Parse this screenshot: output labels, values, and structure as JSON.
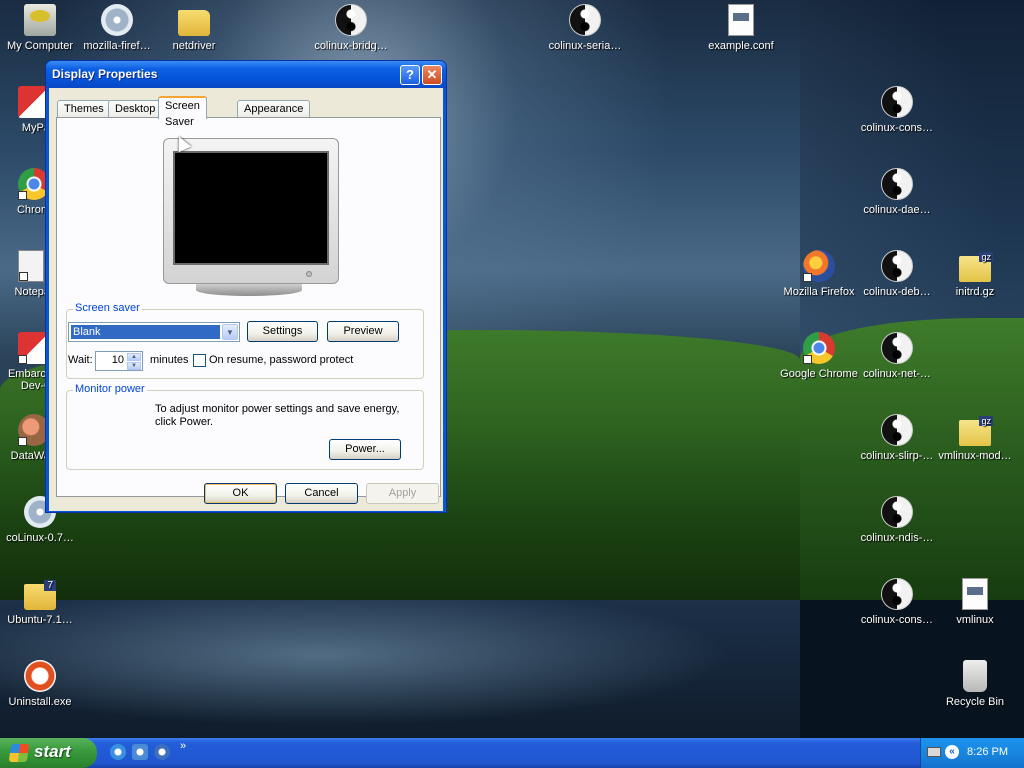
{
  "desktop": {
    "icons_left": [
      {
        "label": "My Computer",
        "icon": "computer-icon"
      },
      {
        "label": "mozilla-firef…",
        "icon": "cd-icon"
      },
      {
        "label": "netdriver",
        "icon": "folder-icon"
      },
      {
        "label": "colinux-bridg…",
        "icon": "yin-yang-icon"
      },
      {
        "label": "colinux-seria…",
        "icon": "yin-yang-icon"
      },
      {
        "label": "example.conf",
        "icon": "config-file-icon"
      },
      {
        "label": "MyPa",
        "icon": "app-icon"
      },
      {
        "label": "Chrom",
        "icon": "chrome-icon"
      },
      {
        "label": "Notepa",
        "icon": "notepad-icon"
      },
      {
        "label": "Embarca Dev-C",
        "icon": "devcpp-icon"
      },
      {
        "label": "DataWa",
        "icon": "database-icon"
      },
      {
        "label": "coLinux-0.7…",
        "icon": "installer-icon"
      },
      {
        "label": "Ubuntu-7.1…",
        "icon": "archive-icon"
      },
      {
        "label": "Uninstall.exe",
        "icon": "uninstall-icon"
      }
    ],
    "icons_right": [
      {
        "label": "colinux-cons…",
        "icon": "yin-yang-icon"
      },
      {
        "label": "colinux-dae…",
        "icon": "yin-yang-icon"
      },
      {
        "label": "Mozilla Firefox",
        "icon": "firefox-icon"
      },
      {
        "label": "colinux-deb…",
        "icon": "yin-yang-icon"
      },
      {
        "label": "initrd.gz",
        "icon": "gz-archive-icon"
      },
      {
        "label": "Google Chrome",
        "icon": "chrome-icon"
      },
      {
        "label": "colinux-net-…",
        "icon": "yin-yang-icon"
      },
      {
        "label": "colinux-slirp-…",
        "icon": "yin-yang-icon"
      },
      {
        "label": "vmlinux-mod…",
        "icon": "gz-archive-icon"
      },
      {
        "label": "colinux-ndis-…",
        "icon": "yin-yang-icon"
      },
      {
        "label": "colinux-cons…",
        "icon": "yin-yang-icon"
      },
      {
        "label": "vmlinux",
        "icon": "file-icon"
      },
      {
        "label": "Recycle Bin",
        "icon": "recycle-bin-icon"
      }
    ]
  },
  "dialog": {
    "title": "Display Properties",
    "help_glyph": "?",
    "close_glyph": "✕",
    "tabs": [
      "Themes",
      "Desktop",
      "Screen Saver",
      "Appearance"
    ],
    "active_tab": "Screen Saver",
    "screen_saver": {
      "group_label": "Screen saver",
      "selected": "Blank",
      "settings_label": "Settings",
      "preview_label": "Preview",
      "wait_label": "Wait:",
      "wait_value": "10",
      "minutes_label": "minutes",
      "password_label": "On resume, password protect",
      "password_checked": false
    },
    "monitor_power": {
      "group_label": "Monitor power",
      "description": "To adjust monitor power settings and save energy, click Power.",
      "power_label": "Power..."
    },
    "ok_label": "OK",
    "cancel_label": "Cancel",
    "apply_label": "Apply"
  },
  "taskbar": {
    "start_label": "start",
    "more_glyph": "»",
    "tray_chevron": "«",
    "clock": "8:26 PM"
  }
}
